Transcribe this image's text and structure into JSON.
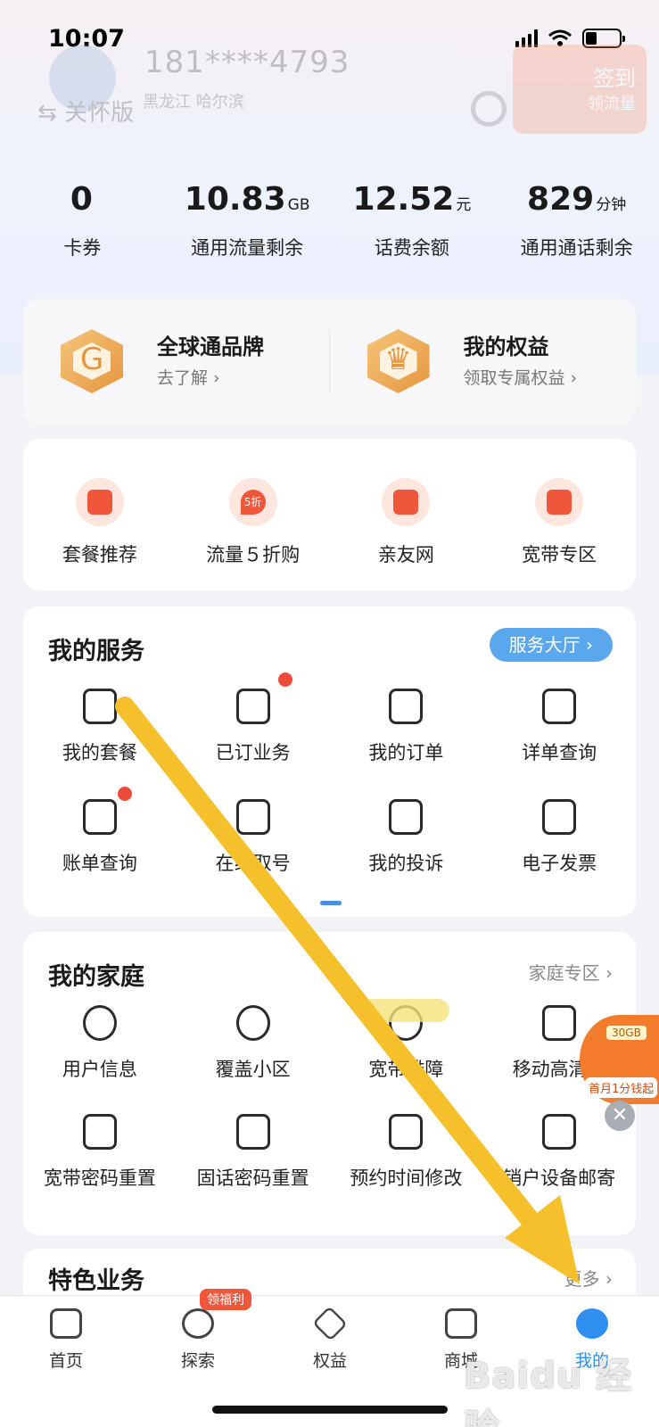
{
  "status": {
    "time": "10:07"
  },
  "profile": {
    "phone": "181****4793",
    "region": "黑龙江 哈尔滨",
    "care_mode": "关怀版",
    "signin": "签到",
    "signin_sub": "领流量"
  },
  "stats": [
    {
      "value": "0",
      "unit": "",
      "label": "卡券"
    },
    {
      "value": "10.83",
      "unit": "GB",
      "label": "通用流量剩余"
    },
    {
      "value": "12.52",
      "unit": "元",
      "label": "话费余额"
    },
    {
      "value": "829",
      "unit": "分钟",
      "label": "通用通话剩余"
    }
  ],
  "brand": [
    {
      "title": "全球通品牌",
      "sub": "去了解 ›",
      "icon": "globe-brand-icon"
    },
    {
      "title": "我的权益",
      "sub": "领取专属权益 ›",
      "icon": "crown-icon"
    }
  ],
  "quick": [
    {
      "label": "套餐推荐",
      "icon": "package-bag-icon",
      "glyph": ""
    },
    {
      "label": "流量５折购",
      "icon": "discount-drop-icon",
      "glyph": "5折"
    },
    {
      "label": "亲友网",
      "icon": "family-house-icon",
      "glyph": ""
    },
    {
      "label": "宽带专区",
      "icon": "router-icon",
      "glyph": ""
    }
  ],
  "services": {
    "title": "我的服务",
    "action": "服务大厅 ›",
    "items": [
      {
        "label": "我的套餐",
        "icon": "shopping-bag-icon"
      },
      {
        "label": "已订业务",
        "icon": "subscribed-bag-icon"
      },
      {
        "label": "我的订单",
        "icon": "clipboard-check-icon"
      },
      {
        "label": "详单查询",
        "icon": "list-document-icon"
      },
      {
        "label": "账单查询",
        "icon": "bill-yuan-icon"
      },
      {
        "label": "在线取号",
        "icon": "queue-ticket-icon"
      },
      {
        "label": "我的投诉",
        "icon": "complaint-chat-icon"
      },
      {
        "label": "电子发票",
        "icon": "invoice-icon"
      }
    ]
  },
  "family": {
    "title": "我的家庭",
    "action": "家庭专区 ›",
    "items": [
      {
        "label": "用户信息",
        "icon": "user-info-icon"
      },
      {
        "label": "覆盖小区",
        "icon": "coverage-icon"
      },
      {
        "label": "宽带排障",
        "icon": "broadband-repair-icon"
      },
      {
        "label": "移动高清报",
        "icon": "hd-tv-icon"
      },
      {
        "label": "宽带密码重置",
        "icon": "broadband-lock-icon"
      },
      {
        "label": "固话密码重置",
        "icon": "landline-lock-icon"
      },
      {
        "label": "预约时间修改",
        "icon": "router-clock-icon"
      },
      {
        "label": "销户设备邮寄",
        "icon": "mail-box-icon"
      }
    ]
  },
  "featured": {
    "title": "特色业务",
    "action": "更多 ›"
  },
  "float_ad": {
    "top": "30GB",
    "bottom": "首月1分钱起"
  },
  "tabs": [
    {
      "label": "首页",
      "icon": "home-store-icon"
    },
    {
      "label": "探索",
      "icon": "compass-icon",
      "badge": "领福利"
    },
    {
      "label": "权益",
      "icon": "diamond-icon"
    },
    {
      "label": "商城",
      "icon": "shop-bag-icon"
    },
    {
      "label": "我的",
      "icon": "user-icon"
    }
  ],
  "watermark": "Baidu 经验",
  "colors": {
    "accent": "#2e8ff0",
    "orange": "#f0563a",
    "arrow": "#f6c02c"
  }
}
